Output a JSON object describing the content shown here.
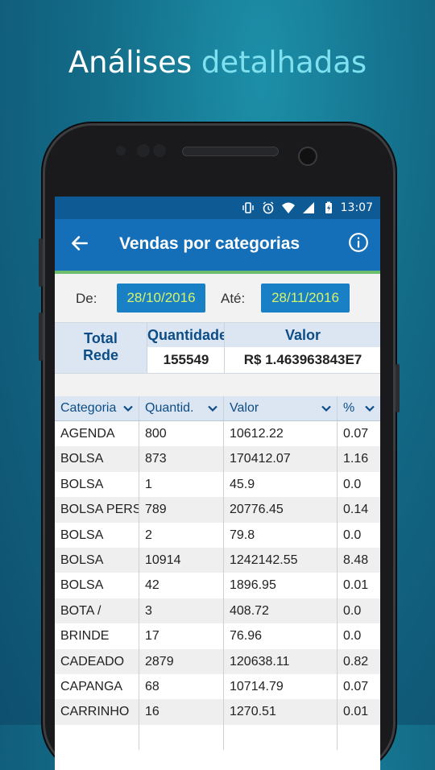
{
  "promo": {
    "headline_part1": "Análises",
    "headline_part2": "detalhadas"
  },
  "status_bar": {
    "time": "13:07",
    "icons": [
      "vibrate-icon",
      "alarm-icon",
      "wifi-icon",
      "signal-icon",
      "battery-charging-icon"
    ]
  },
  "app_bar": {
    "title": "Vendas por categorias",
    "back_icon": "arrow-left-icon",
    "info_icon": "info-icon"
  },
  "filters": {
    "from_label": "De:",
    "from_date": "28/10/2016",
    "to_label": "Até:",
    "to_date": "28/11/2016"
  },
  "summary": {
    "total_label_line1": "Total",
    "total_label_line2": "Rede",
    "quantity_header": "Quantidade",
    "quantity_value": "155549",
    "value_header": "Valor",
    "value_value": "R$ 1.463963843E7"
  },
  "table": {
    "columns": [
      "Categoria",
      "Quantid.",
      "Valor",
      "%"
    ],
    "rows": [
      [
        "AGENDA",
        "800",
        "10612.22",
        "0.07"
      ],
      [
        "BOLSA",
        "873",
        "170412.07",
        "1.16"
      ],
      [
        "BOLSA",
        "1",
        "45.9",
        "0.0"
      ],
      [
        "BOLSA PERS",
        "789",
        "20776.45",
        "0.14"
      ],
      [
        "BOLSA",
        "2",
        "79.8",
        "0.0"
      ],
      [
        "BOLSA",
        "10914",
        "1242142.55",
        "8.48"
      ],
      [
        "BOLSA",
        "42",
        "1896.95",
        "0.01"
      ],
      [
        "BOTA /",
        "3",
        "408.72",
        "0.0"
      ],
      [
        "BRINDE",
        "17",
        "76.96",
        "0.0"
      ],
      [
        "CADEADO",
        "2879",
        "120638.11",
        "0.82"
      ],
      [
        "CAPANGA",
        "68",
        "10714.79",
        "0.07"
      ],
      [
        "CARRINHO",
        "16",
        "1270.51",
        "0.01"
      ],
      [
        "",
        "",
        "",
        ""
      ]
    ]
  },
  "colors": {
    "status_bar": "#0e5a94",
    "app_bar": "#156fb8",
    "accent_line": "#6dbd6f",
    "date_button": "#1a80c6",
    "date_text": "#d6f36a"
  }
}
